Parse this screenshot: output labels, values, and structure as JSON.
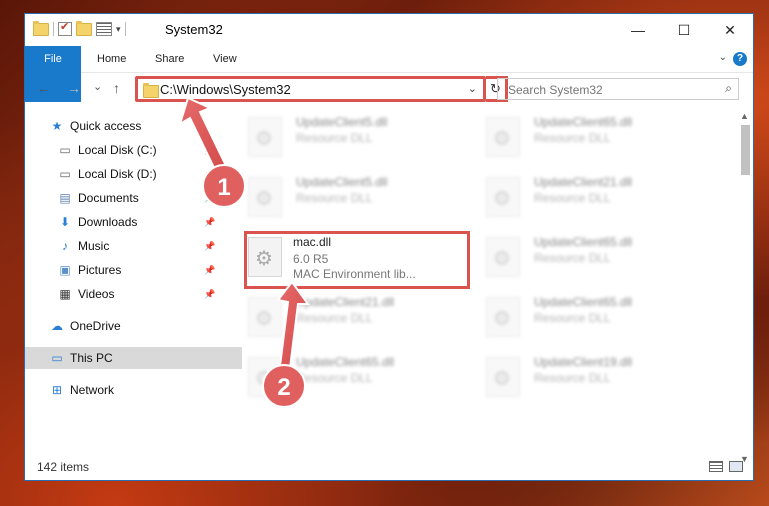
{
  "window": {
    "title": "System32"
  },
  "window_controls": {
    "minimize": "—",
    "maximize": "☐",
    "close": "✕"
  },
  "ribbon": {
    "tabs": [
      "File",
      "Home",
      "Share",
      "View"
    ],
    "help": "?"
  },
  "nav": {
    "back": "←",
    "forward": "→",
    "recent": "⌄",
    "up": "↑"
  },
  "address": {
    "path": "C:\\Windows\\System32",
    "refresh": "↻"
  },
  "search": {
    "placeholder": "Search System32"
  },
  "sidebar": {
    "items": [
      {
        "label": "Quick access",
        "icon": "star-icon"
      },
      {
        "label": "Local Disk (C:)",
        "icon": "drive-icon"
      },
      {
        "label": "Local Disk (D:)",
        "icon": "drive-icon"
      },
      {
        "label": "Documents",
        "icon": "documents-icon"
      },
      {
        "label": "Downloads",
        "icon": "download-icon"
      },
      {
        "label": "Music",
        "icon": "music-icon"
      },
      {
        "label": "Pictures",
        "icon": "pictures-icon"
      },
      {
        "label": "Videos",
        "icon": "videos-icon"
      },
      {
        "label": "OneDrive",
        "icon": "cloud-icon"
      },
      {
        "label": "This PC",
        "icon": "computer-icon"
      },
      {
        "label": "Network",
        "icon": "network-icon"
      }
    ]
  },
  "files": [
    {
      "name": "UpdateClient5.dll",
      "type": "Resource DLL"
    },
    {
      "name": "UpdateClient65.dll",
      "type": "Resource DLL"
    },
    {
      "name": "UpdateClient5.dll",
      "type": "Resource DLL"
    },
    {
      "name": "UpdateClient21.dll",
      "type": "Resource DLL"
    },
    {
      "name": "mac.dll",
      "version": "6.0 R5",
      "type": "MAC Environment lib..."
    },
    {
      "name": "UpdateClient65.dll",
      "type": "Resource DLL"
    },
    {
      "name": "UpdateClient21.dll",
      "type": "Resource DLL"
    },
    {
      "name": "UpdateClient65.dll",
      "type": "Resource DLL"
    },
    {
      "name": "UpdateClient65.dll",
      "type": "Resource DLL"
    },
    {
      "name": "UpdateClient19.dll",
      "type": "Resource DLL"
    }
  ],
  "status": {
    "item_count": "142 items"
  },
  "annotations": {
    "step1": "1",
    "step2": "2",
    "color": "#d9534f"
  }
}
